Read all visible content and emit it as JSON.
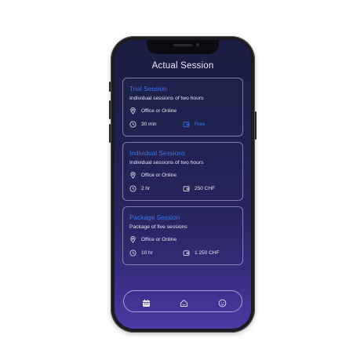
{
  "header": {
    "title": "Actual Session"
  },
  "sessions": [
    {
      "title": "Trial Session",
      "description": "Individual sessions of two hours",
      "location": "Office or Online",
      "duration": "30 min",
      "price": "Free"
    },
    {
      "title": "Individual Sessions",
      "description": "Individual sessions of two hours",
      "location": "Office or Online",
      "duration": "2 hr",
      "price": "250 CHF"
    },
    {
      "title": "Package Session",
      "description": "Package of five sessions",
      "location": "Office or Online",
      "duration": "10 hr",
      "price": "1 250 CHF"
    }
  ],
  "icons": {
    "location": "location-pin-icon",
    "duration": "clock-icon",
    "price": "wallet-icon",
    "nav": [
      "calendar-icon",
      "home-icon",
      "profile-smile-icon"
    ]
  },
  "colors": {
    "accent": "#3d74e6",
    "text": "#e6e6f2",
    "background_top": "#1b1d42",
    "background_bottom": "#4a3aa3"
  }
}
